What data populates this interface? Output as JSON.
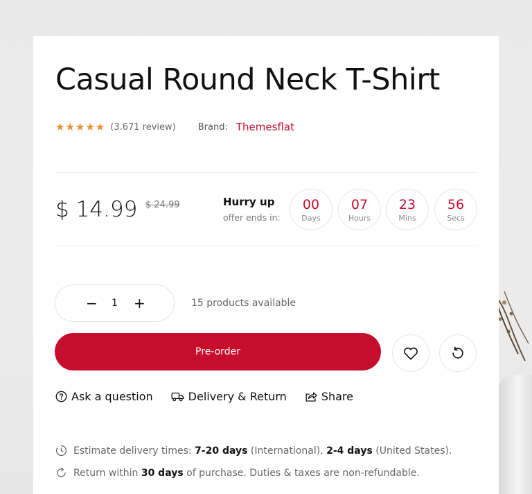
{
  "product": {
    "title": "Casual Round Neck T-Shirt",
    "rating": 5,
    "review_text": "(3.671 review)",
    "brand_label": "Brand:",
    "brand_name": "Themesflat"
  },
  "pricing": {
    "price": "$ 14.99",
    "old_price": "$ 24.99"
  },
  "countdown": {
    "hurry": "Hurry up",
    "offer_text": "offer ends in:",
    "units": [
      {
        "value": "00",
        "label": "Days"
      },
      {
        "value": "07",
        "label": "Hours"
      },
      {
        "value": "23",
        "label": "Mins"
      },
      {
        "value": "56",
        "label": "Secs"
      }
    ]
  },
  "quantity": {
    "minus": "−",
    "value": "1",
    "plus": "+",
    "available": "15 products available"
  },
  "actions": {
    "preorder_label": "Pre-order",
    "wishlist_icon": "heart-icon",
    "compare_icon": "refresh-icon"
  },
  "links": {
    "ask": "Ask a question",
    "delivery": "Delivery & Return",
    "share": "Share"
  },
  "info": {
    "delivery_prefix": "Estimate delivery times:",
    "delivery_intl_days": "7-20 days",
    "delivery_intl_label": "(International),",
    "delivery_us_days": "2-4 days",
    "delivery_us_label": "(United States).",
    "return_prefix": "Return within",
    "return_days": "30 days",
    "return_suffix": "of purchase. Duties & taxes are non-refundable."
  },
  "colors": {
    "accent": "#c60d2e",
    "star": "#e8912e"
  }
}
